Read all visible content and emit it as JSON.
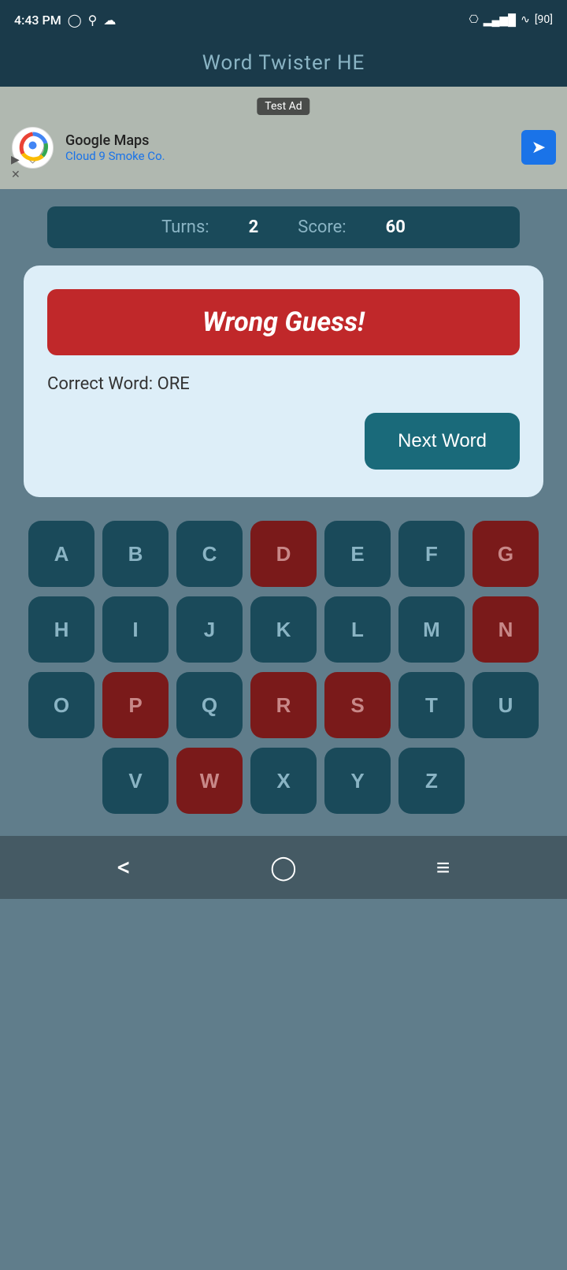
{
  "statusBar": {
    "time": "4:43 PM",
    "battery": "90"
  },
  "appTitle": "Word Twister HE",
  "ad": {
    "label": "Test Ad",
    "company": "Google Maps",
    "subtitle": "Cloud 9 Smoke Co."
  },
  "scoreBar": {
    "turnsLabel": "Turns:",
    "turnsValue": "2",
    "scoreLabel": "Score:",
    "scoreValue": "60"
  },
  "resultCard": {
    "wrongGuessLabel": "Wrong Guess!",
    "correctWordLabel": "Correct Word: ORE",
    "nextWordButton": "Next Word"
  },
  "keyboard": {
    "rows": [
      [
        "A",
        "B",
        "C",
        "D",
        "E",
        "F",
        "G"
      ],
      [
        "H",
        "I",
        "J",
        "K",
        "L",
        "M",
        "N"
      ],
      [
        "O",
        "P",
        "Q",
        "R",
        "S",
        "T",
        "U"
      ],
      [
        "V",
        "W",
        "X",
        "Y",
        "Z"
      ]
    ],
    "usedKeys": [
      "D",
      "G",
      "N",
      "P",
      "R",
      "S",
      "W"
    ]
  },
  "bottomNav": {
    "back": "‹",
    "home": "○",
    "menu": "≡"
  }
}
